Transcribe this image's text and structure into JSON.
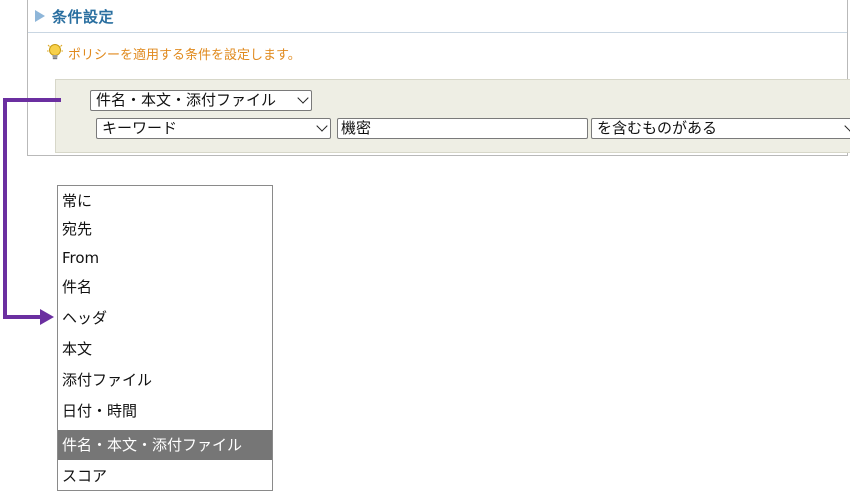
{
  "panel": {
    "title": "条件設定",
    "hint": "ポリシーを適用する条件を設定します。"
  },
  "condition": {
    "field_select": "件名・本文・添付ファイル",
    "type_select": "キーワード",
    "keyword_value": "機密",
    "match_select": "を含むものがある"
  },
  "dropdown": {
    "options": [
      "常に",
      "宛先",
      "From",
      "件名",
      "ヘッダ",
      "本文",
      "添付ファイル",
      "日付・時間",
      "件名・本文・添付ファイル",
      "スコア"
    ],
    "selected_index": 8
  },
  "colors": {
    "accent_arrow": "#6b2fa0",
    "title_blue": "#2a6fa0",
    "hint_orange": "#e08a1e",
    "selected_bg": "#767676"
  }
}
